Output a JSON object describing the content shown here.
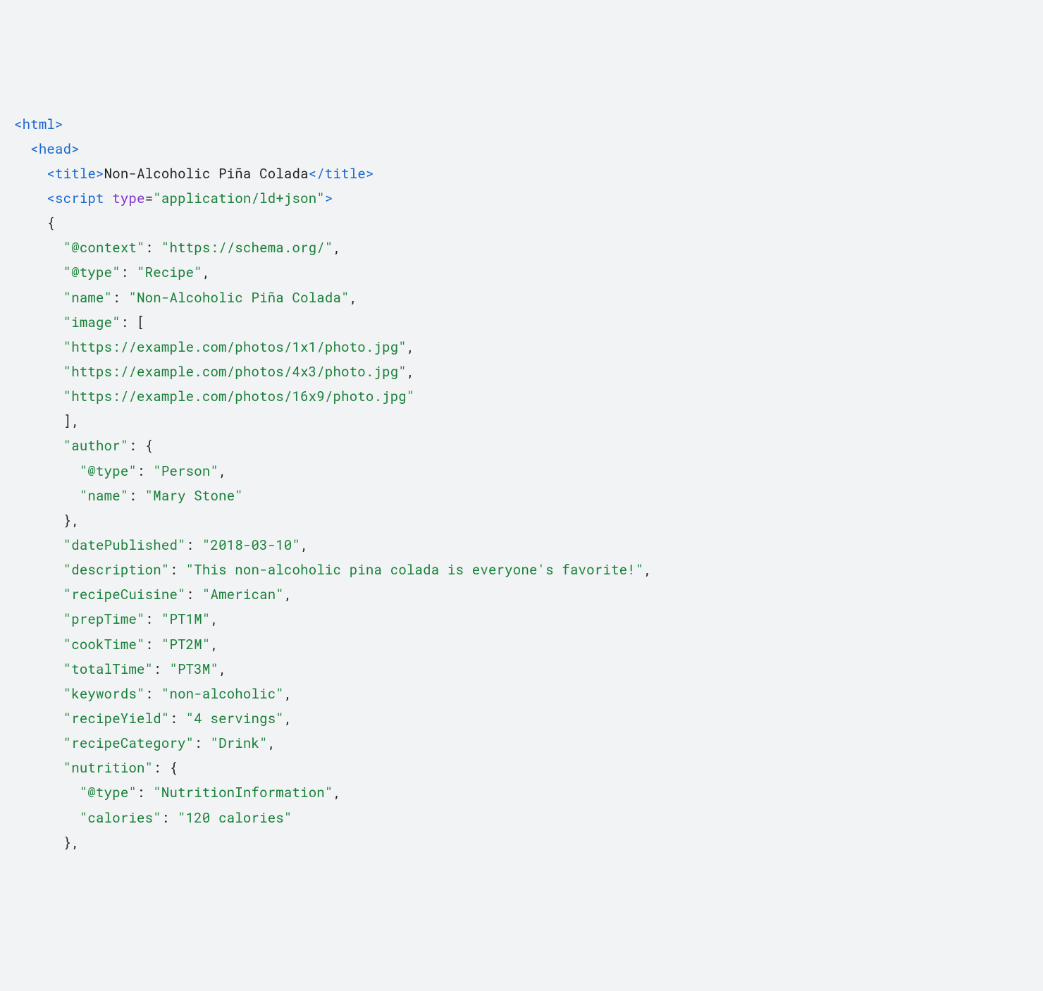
{
  "code": {
    "tags": {
      "html": "html",
      "head": "head",
      "title": "title",
      "script": "script"
    },
    "attrs": {
      "type_name": "type",
      "type_value": "\"application/ld+json\""
    },
    "title_text": "Non-Alcoholic Piña Colada",
    "json": {
      "k_context": "\"@context\"",
      "v_context": "\"https://schema.org/\"",
      "k_type": "\"@type\"",
      "v_type": "\"Recipe\"",
      "k_name": "\"name\"",
      "v_name": "\"Non-Alcoholic Piña Colada\"",
      "k_image": "\"image\"",
      "v_image_0": "\"https://example.com/photos/1x1/photo.jpg\"",
      "v_image_1": "\"https://example.com/photos/4x3/photo.jpg\"",
      "v_image_2": "\"https://example.com/photos/16x9/photo.jpg\"",
      "k_author": "\"author\"",
      "v_author_type": "\"Person\"",
      "k_author_name": "\"name\"",
      "v_author_name": "\"Mary Stone\"",
      "k_datePublished": "\"datePublished\"",
      "v_datePublished": "\"2018-03-10\"",
      "k_description": "\"description\"",
      "v_description": "\"This non-alcoholic pina colada is everyone's favorite!\"",
      "k_recipeCuisine": "\"recipeCuisine\"",
      "v_recipeCuisine": "\"American\"",
      "k_prepTime": "\"prepTime\"",
      "v_prepTime": "\"PT1M\"",
      "k_cookTime": "\"cookTime\"",
      "v_cookTime": "\"PT2M\"",
      "k_totalTime": "\"totalTime\"",
      "v_totalTime": "\"PT3M\"",
      "k_keywords": "\"keywords\"",
      "v_keywords": "\"non-alcoholic\"",
      "k_recipeYield": "\"recipeYield\"",
      "v_recipeYield": "\"4 servings\"",
      "k_recipeCategory": "\"recipeCategory\"",
      "v_recipeCategory": "\"Drink\"",
      "k_nutrition": "\"nutrition\"",
      "v_nutrition_type": "\"NutritionInformation\"",
      "k_calories": "\"calories\"",
      "v_calories": "\"120 calories\""
    }
  }
}
